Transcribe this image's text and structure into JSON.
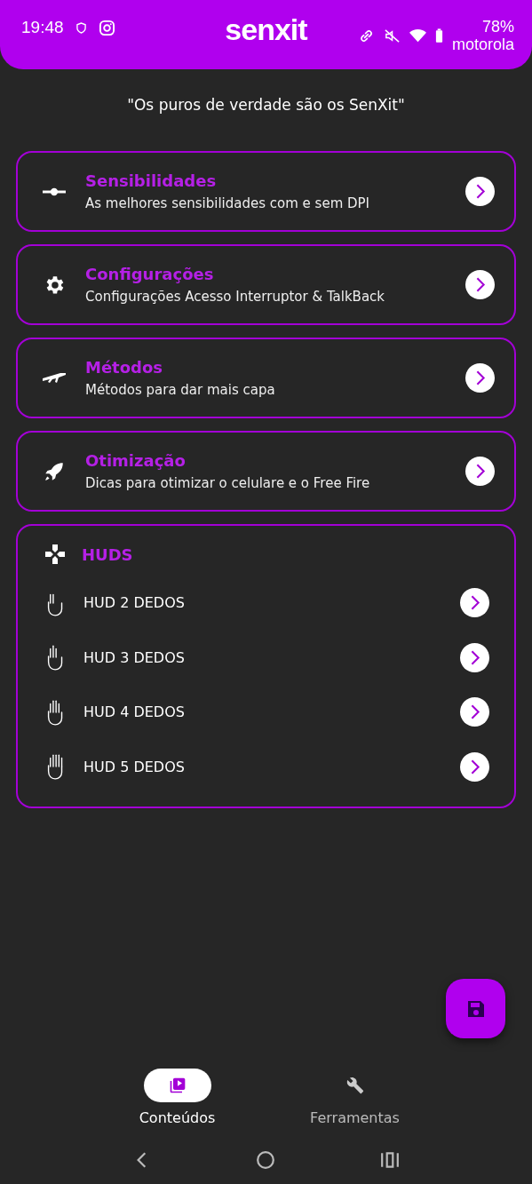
{
  "status_bar": {
    "time": "19:48",
    "battery": "78%",
    "carrier": "motorola"
  },
  "header": {
    "logo": "senxit"
  },
  "slogan": "\"Os puros de verdade são os SenXit\"",
  "menu": [
    {
      "title": "Sensibilidades",
      "subtitle": "As melhores sensibilidades com e sem DPI"
    },
    {
      "title": "Configurações",
      "subtitle": "Configurações Acesso Interruptor & TalkBack"
    },
    {
      "title": "Métodos",
      "subtitle": "Métodos para dar mais capa"
    },
    {
      "title": "Otimização",
      "subtitle": "Dicas para otimizar o celulare e o Free Fire"
    }
  ],
  "huds": {
    "title": "HUDS",
    "items": [
      {
        "label": "HUD 2 DEDOS"
      },
      {
        "label": "HUD 3 DEDOS"
      },
      {
        "label": "HUD 4 DEDOS"
      },
      {
        "label": "HUD 5 DEDOS"
      }
    ]
  },
  "bottom_nav": [
    {
      "label": "Conteúdos",
      "selected": true
    },
    {
      "label": "Ferramentas",
      "selected": false
    }
  ]
}
